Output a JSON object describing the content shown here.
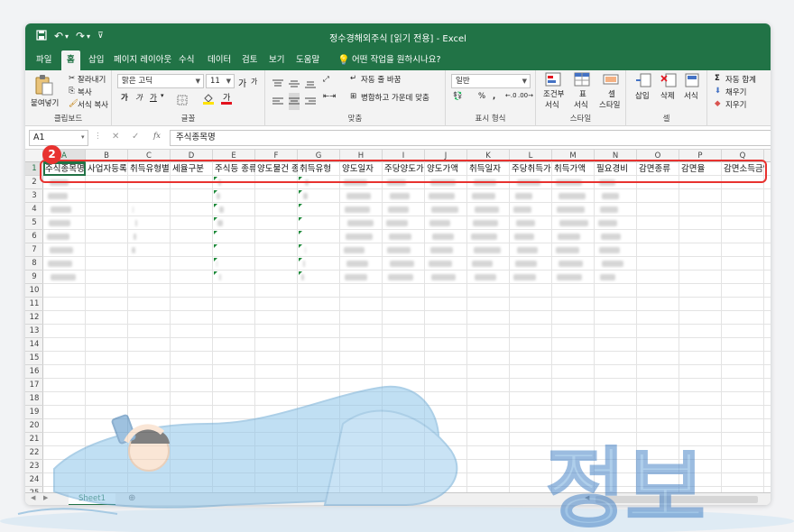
{
  "window": {
    "title": "정수경해외주식 [읽기 전용] - Excel",
    "quick_access": {
      "save_icon": "save-icon",
      "undo_icon": "undo-icon",
      "redo_icon": "redo-icon",
      "customize_icon": "customize-icon"
    }
  },
  "tabs": [
    "파일",
    "홈",
    "삽입",
    "페이지 레이아웃",
    "수식",
    "데이터",
    "검토",
    "보기",
    "도움말"
  ],
  "active_tab": "홈",
  "tell_me": "어떤 작업을 원하시나요?",
  "ribbon": {
    "clipboard": {
      "paste": "붙여넣기",
      "cut": "잘라내기",
      "copy": "복사",
      "format_painter": "서식 복사",
      "group": "클립보드"
    },
    "font": {
      "font_name": "맑은 고딕",
      "font_size": "11",
      "bold": "가",
      "italic": "가",
      "underline": "가",
      "grow": "가",
      "shrink": "가",
      "group": "글꼴"
    },
    "alignment": {
      "wrap": "자동 줄 바꿈",
      "merge": "병합하고 가운데 맞춤",
      "group": "맞춤"
    },
    "number": {
      "format": "일반",
      "percent": "%",
      "comma": ",",
      "group": "표시 형식"
    },
    "styles": {
      "conditional_line1": "조건부",
      "conditional_line2": "서식",
      "table_line1": "표",
      "table_line2": "서식",
      "cell_line1": "셀",
      "cell_line2": "스타일",
      "group": "스타일"
    },
    "cells": {
      "insert": "삽입",
      "delete": "삭제",
      "format": "서식",
      "group": "셀"
    },
    "editing": {
      "autosum": "자동 합계",
      "fill": "채우기",
      "clear": "지우기",
      "group": "편"
    }
  },
  "formula_bar": {
    "name_box": "A1",
    "fx": "fx",
    "cancel": "✕",
    "enter": "✓",
    "content": "주식종목명"
  },
  "columns": [
    "A",
    "B",
    "C",
    "D",
    "E",
    "F",
    "G",
    "H",
    "I",
    "J",
    "K",
    "L",
    "M",
    "N",
    "O",
    "P",
    "Q"
  ],
  "rows": [
    "1",
    "2",
    "3",
    "4",
    "5",
    "6",
    "7",
    "8",
    "9",
    "10",
    "11",
    "12",
    "13",
    "14",
    "15",
    "16",
    "17",
    "18",
    "19",
    "20",
    "21",
    "22",
    "23",
    "24",
    "25"
  ],
  "header_row": [
    "주식종목명",
    "사업자등록",
    "취득유형별",
    "세율구분",
    "주식등 종류",
    "양도물건 종",
    "취득유형",
    "양도일자",
    "주당양도가",
    "양도가액",
    "취득일자",
    "주당취득가",
    "취득가액",
    "필요경비",
    "감면종류",
    "감면율",
    "감면소득금액"
  ],
  "sheet_tab": "Sheet1",
  "annotation": {
    "badge": "2"
  },
  "watermark": "정보",
  "colors": {
    "excel_green": "#217346",
    "highlight_red": "#e8322f"
  }
}
